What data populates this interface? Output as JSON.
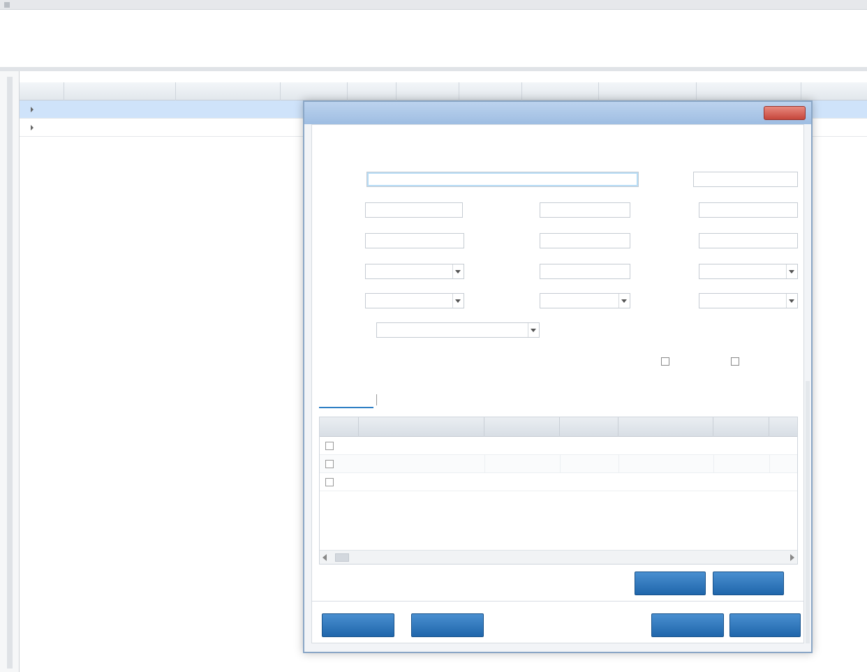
{
  "page": {
    "section_label": ""
  },
  "main_grid": {
    "columns": [
      "",
      "",
      "",
      "",
      "",
      "",
      "",
      "",
      "",
      "",
      ""
    ],
    "rows": [
      {
        "cells": [
          "",
          "",
          "",
          ""
        ],
        "selected": true
      },
      {
        "cells": [
          "",
          "",
          "",
          ""
        ],
        "selected": false
      }
    ]
  },
  "dialog": {
    "title": "",
    "close_label": "",
    "heading": "",
    "fields": {
      "f1": {
        "label": "",
        "value": ""
      },
      "f2": {
        "label": "",
        "value": ""
      },
      "f3": {
        "label": "",
        "value": ""
      },
      "f4": {
        "label": "",
        "value": ""
      },
      "f5": {
        "label": "",
        "value": ""
      },
      "f6": {
        "label": "",
        "value": ""
      },
      "f7": {
        "label": "",
        "value": ""
      },
      "f8": {
        "label": "",
        "value": ""
      },
      "f9": {
        "label": "",
        "value": ""
      },
      "f10": {
        "label": "",
        "value": ""
      },
      "f11": {
        "label": "",
        "value": ""
      },
      "f12": {
        "label": "",
        "value": ""
      },
      "f13": {
        "label": "",
        "value": ""
      },
      "f14": {
        "label": "",
        "value": ""
      },
      "f15": {
        "label": "",
        "value": ""
      },
      "f16": {
        "label": "",
        "value": ""
      }
    },
    "checkboxes": [
      {
        "label": ""
      },
      {
        "label": ""
      }
    ],
    "sub_tabs": [
      "",
      ""
    ],
    "sub_grid": {
      "columns": [
        "",
        "",
        "",
        "",
        "",
        "",
        ""
      ],
      "rows": [
        {
          "label": ""
        },
        {
          "label": ""
        },
        {
          "label": ""
        }
      ]
    },
    "inner_buttons": [
      "",
      ""
    ],
    "footer_buttons": {
      "left": [
        "",
        ""
      ],
      "right": [
        "",
        ""
      ]
    }
  },
  "colors": {
    "accent_blue": "#1f66ab",
    "selected_row": "#cfe3fa",
    "titlebar": "#9ebde2",
    "close_red": "#c5463b"
  }
}
